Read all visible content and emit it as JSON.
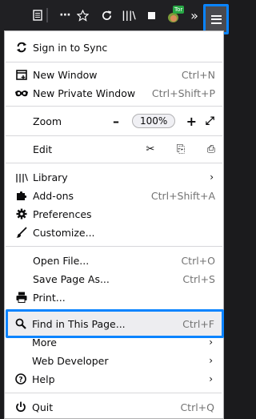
{
  "toolbar": {
    "reader_icon": "reader-view-icon",
    "overflow_label": "⋯",
    "bookmark_icon": "star-icon",
    "reload_icon": "reload-icon",
    "library_label": "|||\\",
    "tor_badge": "Tor",
    "overflow_chevron": "»"
  },
  "menu": {
    "sync": "Sign in to Sync",
    "new_window": {
      "label": "New Window",
      "shortcut": "Ctrl+N"
    },
    "new_private": {
      "label": "New Private Window",
      "shortcut": "Ctrl+Shift+P"
    },
    "zoom": {
      "label": "Zoom",
      "minus": "–",
      "value": "100%",
      "plus": "+",
      "fullscreen": "⤢"
    },
    "edit": {
      "label": "Edit",
      "cut": "✂",
      "copy": "⎘",
      "paste": "⎙"
    },
    "library": "Library",
    "addons": {
      "label": "Add-ons",
      "shortcut": "Ctrl+Shift+A"
    },
    "preferences": "Preferences",
    "customize": "Customize...",
    "open_file": {
      "label": "Open File...",
      "shortcut": "Ctrl+O"
    },
    "save_page": {
      "label": "Save Page As...",
      "shortcut": "Ctrl+S"
    },
    "print": "Print...",
    "find": {
      "label": "Find in This Page...",
      "shortcut": "Ctrl+F"
    },
    "more": "More",
    "web_developer": "Web Developer",
    "help": "Help",
    "quit": {
      "label": "Quit",
      "shortcut": "Ctrl+Q"
    },
    "chevron": "›"
  },
  "colors": {
    "accent": "#0a84ff",
    "toolbar": "#202023",
    "panel": "#ffffff"
  }
}
